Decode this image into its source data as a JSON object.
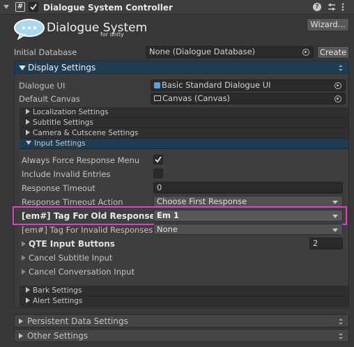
{
  "header": {
    "title": "Dialogue System Controller",
    "enabled": true,
    "icon": "script-hash-icon"
  },
  "logo": {
    "main": "Dialogue System",
    "sub": "for unity"
  },
  "wizard_label": "Wizard...",
  "initial_database": {
    "label": "Initial Database",
    "value": "None (Dialogue Database)",
    "create_label": "Create"
  },
  "display_settings": {
    "title": "Display Settings",
    "dialogue_ui": {
      "label": "Dialogue UI",
      "value": "Basic Standard Dialogue UI"
    },
    "default_canvas": {
      "label": "Default Canvas",
      "value": "Canvas (Canvas)"
    },
    "subsections": {
      "localization": "Localization Settings",
      "subtitle": "Subtitle Settings",
      "camera": "Camera & Cutscene Settings",
      "input": "Input Settings",
      "bark": "Bark Settings",
      "alert": "Alert Settings"
    },
    "input": {
      "always_force": {
        "label": "Always Force Response Menu",
        "checked": true
      },
      "include_invalid": {
        "label": "Include Invalid Entries",
        "checked": false
      },
      "response_timeout": {
        "label": "Response Timeout",
        "value": "0"
      },
      "timeout_action": {
        "label": "Response Timeout Action",
        "value": "Choose First Response"
      },
      "tag_old": {
        "label": "[em#] Tag For Old Responses",
        "value": "Em 1"
      },
      "tag_invalid": {
        "label": "[em#] Tag For Invalid Responses",
        "value": "None"
      },
      "qte": {
        "label": "QTE Input Buttons",
        "value": "2"
      },
      "cancel_subtitle": "Cancel Subtitle Input",
      "cancel_conversation": "Cancel Conversation Input"
    }
  },
  "persistent_data": "Persistent Data Settings",
  "other_settings": "Other Settings",
  "colors": {
    "highlight": "#e040c8",
    "section_header": "#1f3d52",
    "accent": "#3d78c8"
  }
}
